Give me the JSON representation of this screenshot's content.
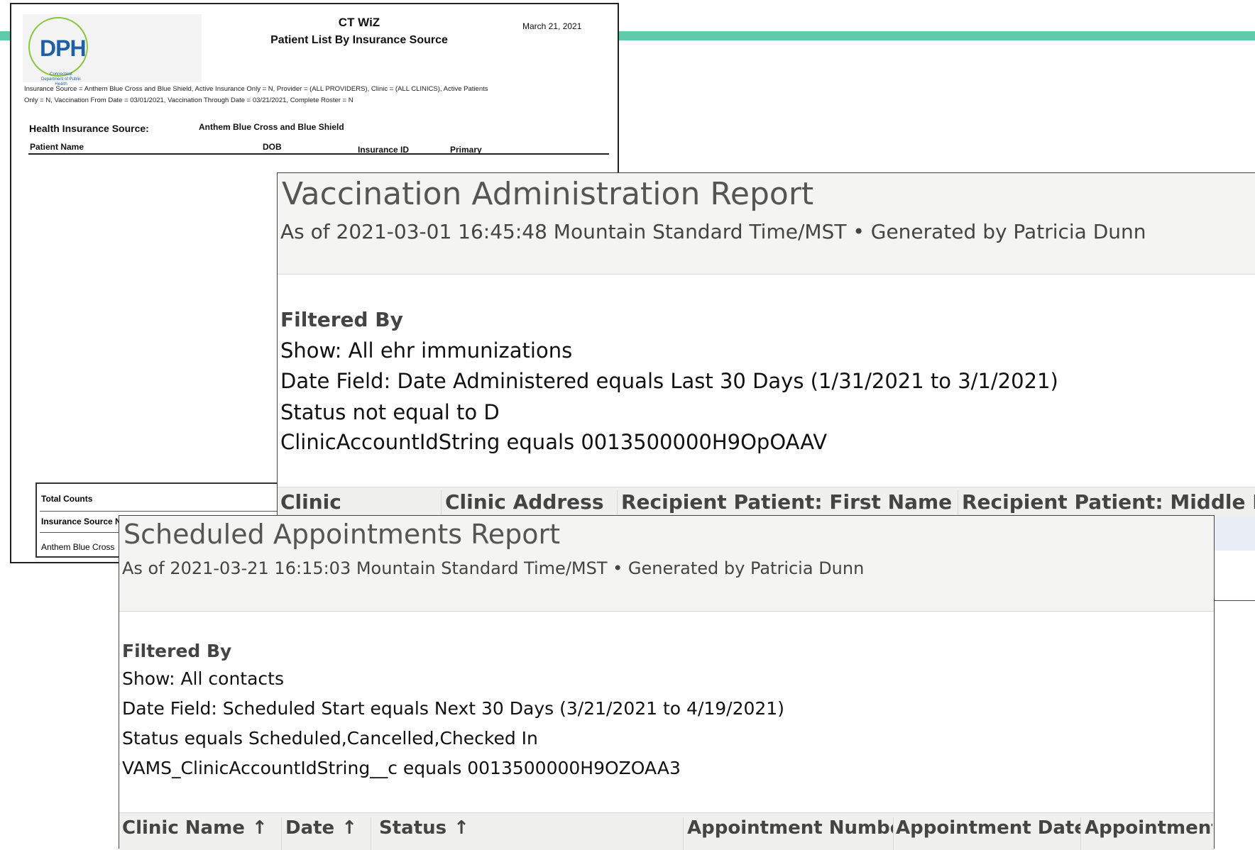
{
  "colors": {
    "accent_bar": "#5fcbac",
    "dph_blue": "#1f5fa8",
    "dph_green": "#8cc63f"
  },
  "ctwiz": {
    "logo_text": "DPH",
    "logo_subtext": "Connecticut Department of Public Health",
    "title": "CT WiZ",
    "subtitle": "Patient List By Insurance Source",
    "date": "March 21, 2021",
    "criteria_line1": "Insurance Source = Anthem Blue Cross and Blue Shield, Active Insurance Only = N, Provider = (ALL PROVIDERS), Clinic = (ALL CLINICS), Active Patients",
    "criteria_line2": "Only = N, Vaccination From Date = 03/01/2021, Vaccination Through Date = 03/21/2021, Complete Roster = N",
    "his_label": "Health Insurance Source:",
    "his_value": "Anthem Blue Cross and Blue Shield",
    "columns": [
      "Patient Name",
      "DOB",
      "Insurance ID",
      "Primary"
    ],
    "totals_label": "Total Counts",
    "insurance_source_label": "Insurance Source N",
    "insurance_source_value": "Anthem Blue Cross"
  },
  "vaccination_report": {
    "title": "Vaccination Administration Report",
    "subtitle": "As of 2021-03-01 16:45:48 Mountain Standard Time/MST • Generated by Patricia Dunn",
    "filtered_by": "Filtered By",
    "filters": [
      "Show: All ehr immunizations",
      "Date Field: Date Administered equals Last 30 Days (1/31/2021 to 3/1/2021)",
      "Status not equal to D",
      "ClinicAccountIdString equals 0013500000H9OpOAAV"
    ],
    "columns": [
      "Clinic",
      "Clinic Address",
      "Recipient Patient: First Name",
      "Recipient Patient: Middle Nar"
    ]
  },
  "scheduled_report": {
    "title": "Scheduled Appointments Report",
    "subtitle": "As of 2021-03-21 16:15:03 Mountain Standard Time/MST • Generated by Patricia Dunn",
    "filtered_by": "Filtered By",
    "filters": [
      "Show: All contacts",
      "Date Field: Scheduled Start equals Next 30 Days (3/21/2021 to 4/19/2021)",
      "Status equals Scheduled,Cancelled,Checked In",
      "VAMS_ClinicAccountIdString__c equals 0013500000H9OZOAA3"
    ],
    "columns": [
      "Clinic Name",
      "Date",
      "Status",
      "Appointment Numbe",
      "Appointment Date",
      "Appointment Start Time"
    ],
    "sort_icon": "↑"
  }
}
